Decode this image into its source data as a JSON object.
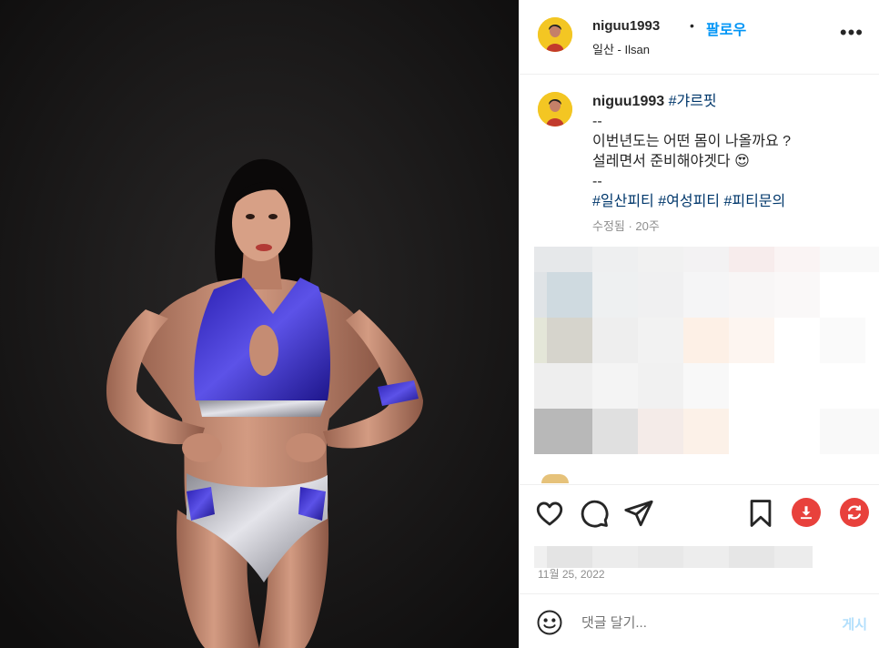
{
  "post": {
    "username": "niguu1993",
    "separator": "•",
    "follow_label": "팔로우",
    "location": "일산 - Ilsan",
    "more_icon": "more-horizontal-icon"
  },
  "caption": {
    "username": "niguu1993",
    "tag_first": "#갸르핏",
    "line_dash1": "--",
    "line_1": "이번년도는 어떤 몸이 나올까요 ?",
    "line_2": "설레면서 준비해야겟다 😍",
    "line_dash2": "--",
    "tag_a": "#일산피티",
    "tag_b": "#여성피티",
    "tag_c": "#피티문의",
    "meta": "수정됨 · 20주"
  },
  "actions": {
    "icons": [
      "heart-icon",
      "comment-icon",
      "share-icon",
      "bookmark-icon",
      "download-icon",
      "refresh-icon"
    ],
    "download_color": "#e8413c",
    "refresh_color": "#e8413c"
  },
  "date": "11월 25, 2022",
  "comment": {
    "placeholder": "댓글 달기...",
    "post_label": "게시"
  },
  "colors": {
    "accent": "#0095f6",
    "tag": "#00376b",
    "muted": "#8e8e8e",
    "media_bg": "#151414"
  }
}
